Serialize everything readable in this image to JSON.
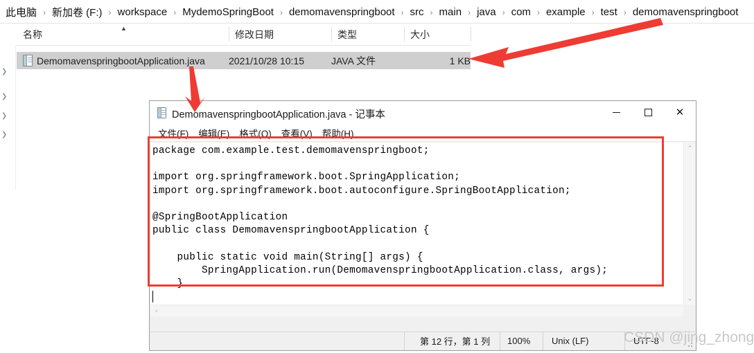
{
  "explorer": {
    "breadcrumb": {
      "separator": "›",
      "items": [
        "此电脑",
        "新加卷 (F:)",
        "workspace",
        "MydemoSpringBoot",
        "demomavenspringboot",
        "src",
        "main",
        "java",
        "com",
        "example",
        "test",
        "demomavenspringboot"
      ]
    },
    "columns": [
      {
        "label": "名称",
        "sort": "asc"
      },
      {
        "label": "修改日期",
        "sort": ""
      },
      {
        "label": "类型",
        "sort": ""
      },
      {
        "label": "大小",
        "sort": ""
      }
    ],
    "rows": [
      {
        "name": "DemomavenspringbootApplication.java",
        "modified": "2021/10/28 10:15",
        "type": "JAVA 文件",
        "size": "1 KB",
        "icon": "java-text-file-icon",
        "selected": true
      }
    ]
  },
  "notepad": {
    "title": "DemomavenspringbootApplication.java - 记事本",
    "title_icon": "notepad-document-icon",
    "window_buttons": {
      "minimize": "－",
      "maximize": "□",
      "close": "✕"
    },
    "menu": [
      "文件(F)",
      "编辑(E)",
      "格式(O)",
      "查看(V)",
      "帮助(H)"
    ],
    "content": "package com.example.test.demomavenspringboot;\n\nimport org.springframework.boot.SpringApplication;\nimport org.springframework.boot.autoconfigure.SpringBootApplication;\n\n@SpringBootApplication\npublic class DemomavenspringbootApplication {\n\n    public static void main(String[] args) {\n        SpringApplication.run(DemomavenspringbootApplication.class, args);\n    }\n\n}",
    "status": {
      "position": "第 12 行，第 1 列",
      "zoom": "100%",
      "line_ending": "Unix (LF)",
      "encoding": "UTF-8"
    },
    "scrollbars": {
      "up_arrow": "⌃",
      "down_arrow": "⌄",
      "left_arrow": "‹"
    }
  },
  "annotations": {
    "color": "#ee3b33",
    "arrow_to_size": "arrow-pointing-to-file-size",
    "arrow_to_notepad": "arrow-pointing-to-notepad-title",
    "highlight_box": "red-rectangle-around-java-code"
  },
  "watermark": {
    "text": "CSDN @jing_zhong"
  }
}
